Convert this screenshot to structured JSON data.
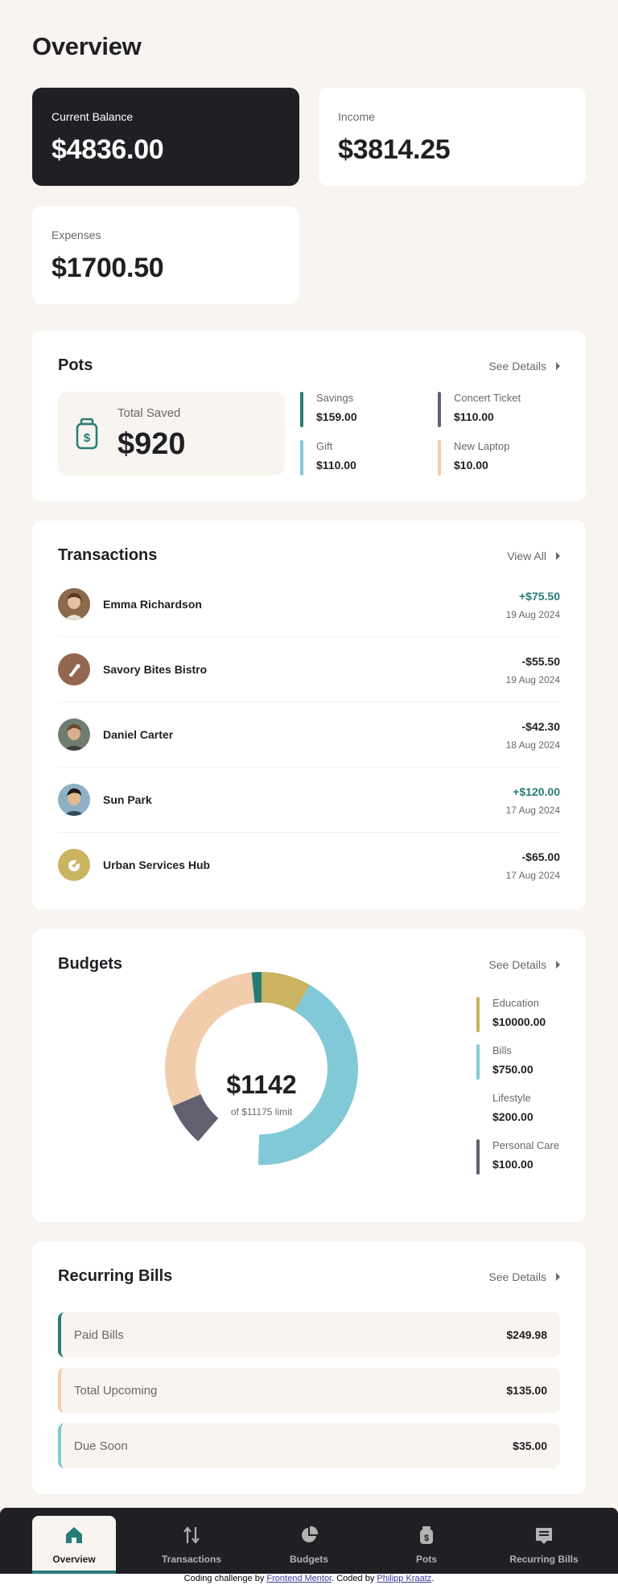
{
  "overview": {
    "title": "Overview"
  },
  "summary": {
    "balance": {
      "label": "Current Balance",
      "value": "$4836.00"
    },
    "income": {
      "label": "Income",
      "value": "$3814.25"
    },
    "expenses": {
      "label": "Expenses",
      "value": "$1700.50"
    }
  },
  "pots": {
    "title": "Pots",
    "link": "See Details",
    "total_label": "Total Saved",
    "total_value": "$920",
    "items": [
      {
        "name": "Savings",
        "amount": "$159.00",
        "color": "#277c78"
      },
      {
        "name": "Concert Ticket",
        "amount": "$110.00",
        "color": "#626070"
      },
      {
        "name": "Gift",
        "amount": "$110.00",
        "color": "#82c9d7"
      },
      {
        "name": "New Laptop",
        "amount": "$10.00",
        "color": "#f2cdac"
      }
    ]
  },
  "transactions": {
    "title": "Transactions",
    "link": "View All",
    "items": [
      {
        "name": "Emma Richardson",
        "amount": "+$75.50",
        "date": "19 Aug 2024",
        "avatar": "person-avatar"
      },
      {
        "name": "Savory Bites Bistro",
        "amount": "-$55.50",
        "date": "19 Aug 2024",
        "avatar": "restaurant-icon"
      },
      {
        "name": "Daniel Carter",
        "amount": "-$42.30",
        "date": "18 Aug 2024",
        "avatar": "person-avatar"
      },
      {
        "name": "Sun Park",
        "amount": "+$120.00",
        "date": "17 Aug 2024",
        "avatar": "person-avatar"
      },
      {
        "name": "Urban Services Hub",
        "amount": "-$65.00",
        "date": "17 Aug 2024",
        "avatar": "services-icon"
      }
    ]
  },
  "budgets": {
    "title": "Budgets",
    "link": "See Details",
    "spent": "$1142",
    "limit": "of $11175 limit",
    "legend": [
      {
        "name": "Education",
        "amount": "$10000.00",
        "color": "#cab361"
      },
      {
        "name": "Bills",
        "amount": "$750.00",
        "color": "#82c9d7"
      },
      {
        "name": "Lifestyle",
        "amount": "$200.00",
        "color": ""
      },
      {
        "name": "Personal Care",
        "amount": "$100.00",
        "color": "#626070"
      }
    ]
  },
  "bills": {
    "title": "Recurring Bills",
    "link": "See Details",
    "items": [
      {
        "name": "Paid Bills",
        "amount": "$249.98",
        "color": "#277c78"
      },
      {
        "name": "Total Upcoming",
        "amount": "$135.00",
        "color": "#f2cdac"
      },
      {
        "name": "Due Soon",
        "amount": "$35.00",
        "color": "#82c9d7"
      }
    ]
  },
  "nav": {
    "items": [
      {
        "label": "Overview",
        "icon": "home-icon",
        "active": true
      },
      {
        "label": "Transactions",
        "icon": "arrows-icon",
        "active": false
      },
      {
        "label": "Budgets",
        "icon": "pie-icon",
        "active": false
      },
      {
        "label": "Pots",
        "icon": "jar-icon",
        "active": false
      },
      {
        "label": "Recurring Bills",
        "icon": "receipt-icon",
        "active": false
      }
    ]
  },
  "attribution": {
    "prefix": "Coding challenge by ",
    "link1": "Frontend Mentor",
    "middle": ". Coded by ",
    "link2": "Philipp Kraatz",
    "suffix": "."
  }
}
